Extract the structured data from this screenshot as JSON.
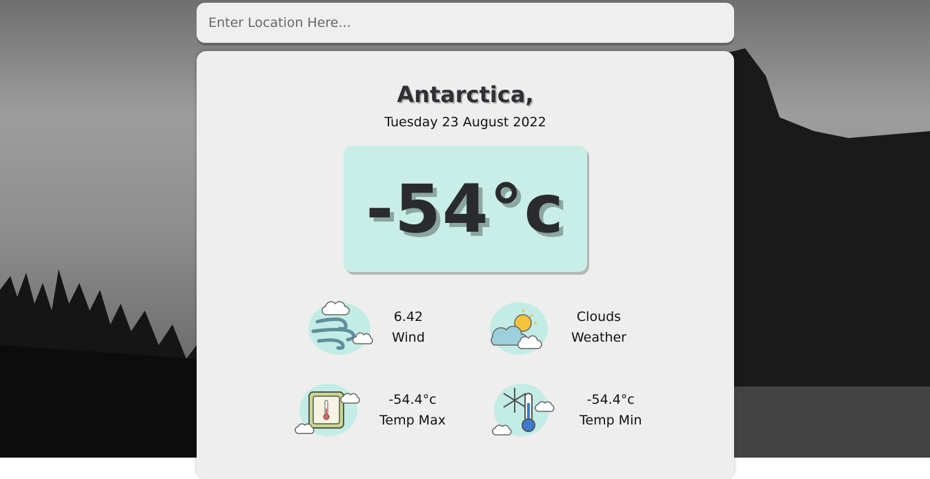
{
  "search": {
    "placeholder": "Enter Location Here..."
  },
  "weather": {
    "location": "Antarctica,",
    "date": "Tuesday 23 August 2022",
    "temperature": "-54°c"
  },
  "stats": [
    {
      "value": "6.42",
      "label": "Wind",
      "icon": "wind-icon"
    },
    {
      "value": "Clouds",
      "label": "Weather",
      "icon": "cloud-sun-icon"
    },
    {
      "value": "-54.4°c",
      "label": "Temp Max",
      "icon": "thermometer-icon"
    },
    {
      "value": "-54.4°c",
      "label": "Temp Min",
      "icon": "snow-thermometer-icon"
    }
  ],
  "colors": {
    "card_bg": "#eeeeee",
    "temp_box_bg": "#c8eee7",
    "icon_splash": "#c4ece6"
  }
}
